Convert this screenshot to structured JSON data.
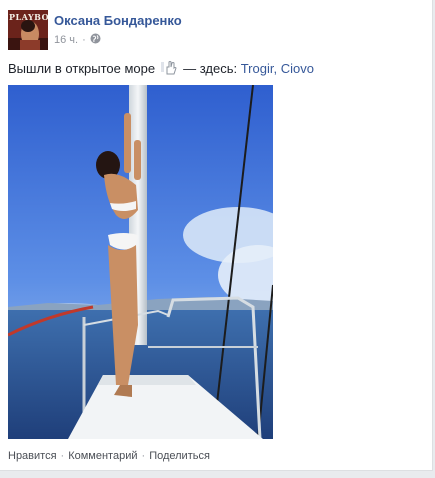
{
  "post": {
    "author": "Оксана Бондаренко",
    "avatar_logo_text": "PLAYBOY",
    "time": "16 ч.",
    "time_separator": "·",
    "privacy_icon": "globe-icon",
    "text": "Вышли в открытое море",
    "feeling_icon": "hand-icon",
    "location_prefix": "— здесь:",
    "location": "Trogir, Ciovo"
  },
  "actions": {
    "like": "Нравится",
    "comment": "Комментарий",
    "share": "Поделиться",
    "separator": "·"
  },
  "colors": {
    "link": "#365899",
    "meta": "#90949c",
    "background": "#e9ebee"
  }
}
